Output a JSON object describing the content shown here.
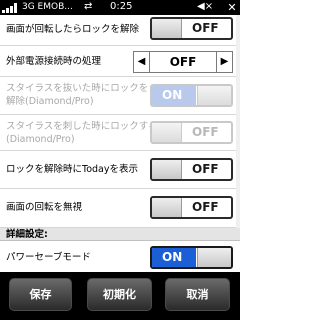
{
  "status_bar": {
    "carrier": "3G EMOB...",
    "time": "0:25",
    "sync_glyph": "⇄",
    "volume_glyph": "◀×",
    "close_glyph": "✕",
    "icons": [
      "signal-icon",
      "sync-icon",
      "volume-muted-icon",
      "close-icon"
    ]
  },
  "settings": {
    "rotate_lock": {
      "label": "画面が回転したらロックを解除",
      "state": "OFF"
    },
    "external_power": {
      "label": "外部電源接続時の処理",
      "value": "OFF",
      "left_arrow": "◀",
      "right_arrow": "▶"
    },
    "stylus_out_unlock": {
      "label_line1": "スタイラスを抜いた時にロックを",
      "label_line2": "解除(Diamond/Pro)",
      "state": "ON"
    },
    "stylus_in_lock": {
      "label_line1": "スタイラスを刺した時にロックする",
      "label_line2": "(Diamond/Pro)",
      "state": "OFF"
    },
    "show_today": {
      "label": "ロックを解除時にTodayを表示",
      "state": "OFF"
    },
    "ignore_rotation": {
      "label": "画面の回転を無視",
      "state": "OFF"
    }
  },
  "advanced": {
    "header": "詳細設定:",
    "power_save": {
      "label": "パワーセーブモード",
      "state": "ON"
    }
  },
  "bottom_bar": {
    "save_label": "保存",
    "reset_label": "初期化",
    "cancel_label": "取消"
  },
  "colors": {
    "on_fill": "#1b5fd6",
    "status_bar_bg": "#000000"
  }
}
